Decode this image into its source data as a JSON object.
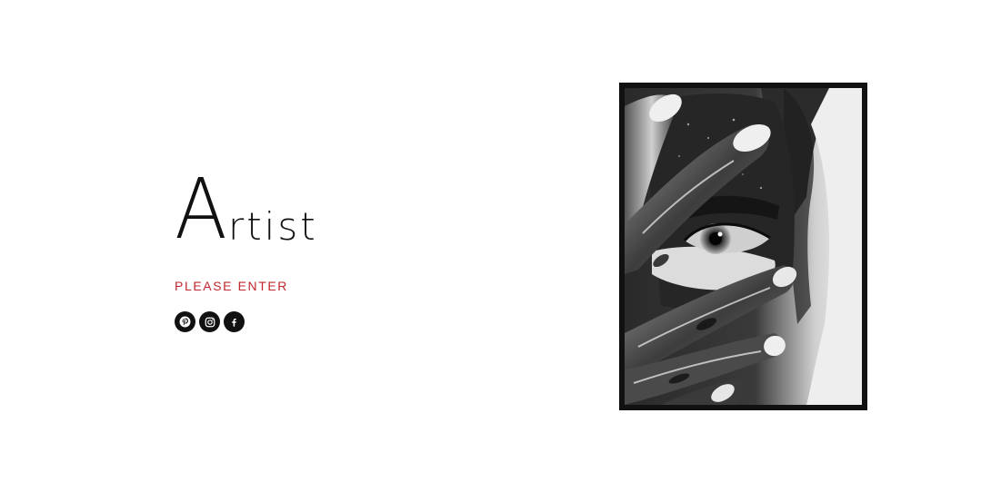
{
  "hero": {
    "title_initial": "A",
    "title_rest": "rtist",
    "enter_label": "PLEASE ENTER"
  },
  "social": [
    {
      "icon": "pinterest-icon"
    },
    {
      "icon": "instagram-icon"
    },
    {
      "icon": "facebook-icon"
    }
  ],
  "colors": {
    "accent": "#c0272d",
    "text": "#111111",
    "background": "#ffffff",
    "frame": "#111111"
  },
  "image": {
    "subject": "black-and-white portrait, eye peeking between paint-covered fingers"
  }
}
